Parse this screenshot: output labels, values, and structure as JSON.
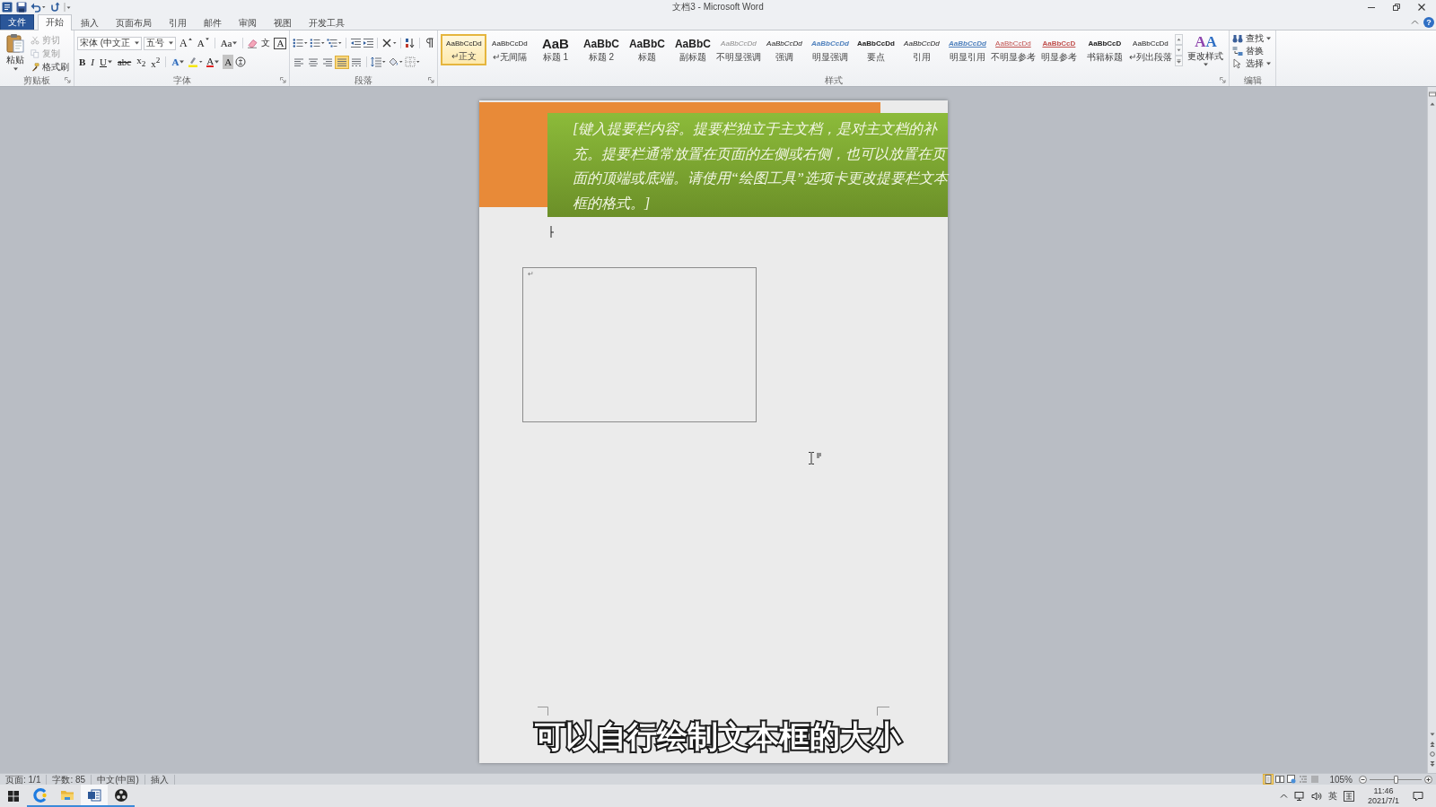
{
  "window": {
    "title": "文档3 - Microsoft Word",
    "help": "?"
  },
  "tabs": [
    {
      "label": "文件",
      "kind": "file",
      "selected": false
    },
    {
      "label": "开始",
      "kind": "tab",
      "selected": true
    },
    {
      "label": "插入",
      "kind": "tab",
      "selected": false
    },
    {
      "label": "页面布局",
      "kind": "tab",
      "selected": false
    },
    {
      "label": "引用",
      "kind": "tab",
      "selected": false
    },
    {
      "label": "邮件",
      "kind": "tab",
      "selected": false
    },
    {
      "label": "审阅",
      "kind": "tab",
      "selected": false
    },
    {
      "label": "视图",
      "kind": "tab",
      "selected": false
    },
    {
      "label": "开发工具",
      "kind": "tab",
      "selected": false
    }
  ],
  "clipboard": {
    "label": "剪贴板",
    "paste": "粘贴",
    "items": [
      {
        "label": "剪切",
        "disabled": true
      },
      {
        "label": "复制",
        "disabled": true
      },
      {
        "label": "格式刷",
        "disabled": false
      }
    ]
  },
  "font": {
    "label": "字体",
    "name_box": "宋体 (中文正",
    "size_box": "五号",
    "grow": "A",
    "shrink": "A",
    "change_case": "Aa",
    "phonetic": "文",
    "char_border": "A",
    "format": [
      "B",
      "I",
      "U",
      "abc",
      "x$_{2}$",
      "x$^{2}$"
    ],
    "effects": "A",
    "font_color": "A",
    "char_shading": "A"
  },
  "paragraph": {
    "label": "段落",
    "alignment": [
      {
        "kind": "left",
        "selected": false
      },
      {
        "kind": "center",
        "selected": false
      },
      {
        "kind": "right",
        "selected": false
      },
      {
        "kind": "justify",
        "selected": true
      },
      {
        "kind": "distributed",
        "selected": false
      }
    ]
  },
  "styles": {
    "label": "样式",
    "gallery": [
      {
        "preview": "AaBbCcDd",
        "name": "↵正文",
        "kind": "normal",
        "selected": true
      },
      {
        "preview": "AaBbCcDd",
        "name": "↵无间隔",
        "kind": "normal",
        "selected": false
      },
      {
        "preview": "AaB",
        "name": "标题 1",
        "kind": "heading1",
        "selected": false
      },
      {
        "preview": "AaBbC",
        "name": "标题 2",
        "kind": "heading2",
        "selected": false
      },
      {
        "preview": "AaBbC",
        "name": "标题",
        "kind": "title",
        "selected": false
      },
      {
        "preview": "AaBbC",
        "name": "副标题",
        "kind": "subtitle",
        "selected": false
      },
      {
        "preview": "AaBbCcDd",
        "name": "不明显强调",
        "kind": "subtle-emphasis",
        "selected": false
      },
      {
        "preview": "AaBbCcDd",
        "name": "强调",
        "kind": "emphasis",
        "selected": false
      },
      {
        "preview": "AaBbCcDd",
        "name": "明显强调",
        "kind": "intense-emphasis",
        "selected": false
      },
      {
        "preview": "AaBbCcDd",
        "name": "要点",
        "kind": "strong",
        "selected": false
      },
      {
        "preview": "AaBbCcDd",
        "name": "引用",
        "kind": "quote",
        "selected": false
      },
      {
        "preview": "AaBbCcDd",
        "name": "明显引用",
        "kind": "intense-quote",
        "selected": false
      },
      {
        "preview": "AaBbCcDd",
        "name": "不明显参考",
        "kind": "subtle-reference",
        "selected": false
      },
      {
        "preview": "AaBbCcD",
        "name": "明显参考",
        "kind": "intense-reference",
        "selected": false
      },
      {
        "preview": "AaBbCcD",
        "name": "书籍标题",
        "kind": "book-title",
        "selected": false
      },
      {
        "preview": "AaBbCcDd",
        "name": "↵列出段落",
        "kind": "normal",
        "selected": false
      }
    ],
    "change_glyphs": [
      "A",
      "A"
    ],
    "change_label": "更改样式"
  },
  "editing": {
    "label": "编辑",
    "items": [
      "查找",
      "替换",
      "选择"
    ]
  },
  "document": {
    "sidebar_text": "[键入提要栏内容。提要栏独立于主文档，是对主文档的补充。提要栏通常放置在页面的左侧或右侧，也可以放置在页面的顶端或底端。请使用“绘图工具”选项卡更改提要栏文本框的格式。]",
    "paragraph_mark": "↵"
  },
  "caption": "可以自行绘制文本框的大小",
  "status_bar": {
    "items": [
      "页面: 1/1",
      "字数: 85",
      "中文(中国)",
      "插入"
    ],
    "views": [
      {
        "selected": true
      },
      {
        "selected": false
      },
      {
        "selected": false
      },
      {
        "selected": false
      },
      {
        "selected": false
      }
    ],
    "zoom": "105%",
    "zoom_slider": {
      "level": 0.5
    }
  },
  "taskbar": {
    "apps": [
      {
        "running": true,
        "active": false
      },
      {
        "running": true,
        "active": false
      },
      {
        "running": true,
        "active": true
      },
      {
        "running": true,
        "active": false
      }
    ],
    "ime_language": "英",
    "time": "11:46",
    "date": "2021/7/1"
  }
}
